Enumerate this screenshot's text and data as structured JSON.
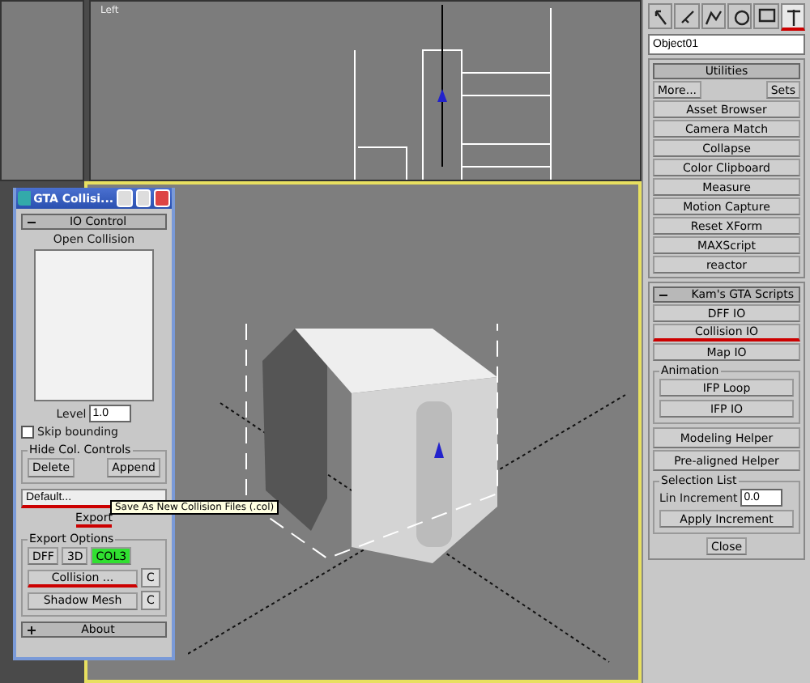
{
  "top_viewport": {
    "label": "Left"
  },
  "float_window": {
    "title": "GTA Collisi...",
    "io_rollout": {
      "title": "IO Control",
      "expanded": true,
      "open_label": "Open Collision",
      "level_label": "Level",
      "level_value": "1.0",
      "skip": {
        "label": "Skip bounding",
        "checked": false
      }
    },
    "hide_group": {
      "title": "Hide Col. Controls",
      "buttons": [
        "Delete",
        "Append"
      ]
    },
    "name_value": "Default...",
    "export_label": "Export",
    "export_group": {
      "title": "Export Options",
      "formats": [
        {
          "label": "DFF",
          "selected": false
        },
        {
          "label": "3D",
          "selected": false
        },
        {
          "label": "COL3",
          "selected": true
        }
      ]
    },
    "tooltip": "Save As New Collision Files (.col)",
    "rows": [
      {
        "label": "Collision ...",
        "value": "C",
        "underlined": true
      },
      {
        "label": "Shadow Mesh",
        "value": "C",
        "underlined": false
      }
    ],
    "about_rollout": {
      "title": "About",
      "expanded": false
    }
  },
  "command_panel": {
    "tabs": [
      {
        "selected": false
      },
      {
        "selected": false
      },
      {
        "selected": false
      },
      {
        "selected": false
      },
      {
        "selected": false
      },
      {
        "selected": true
      }
    ],
    "object_name": "Object01",
    "utilities": {
      "title": "Utilities",
      "more": "More...",
      "sets": "Sets",
      "items": [
        "Asset Browser",
        "Camera Match",
        "Collapse",
        "Color Clipboard",
        "Measure",
        "Motion Capture",
        "Reset XForm",
        "MAXScript",
        "reactor"
      ]
    },
    "scripts": {
      "title": "Kam's GTA Scripts",
      "expanded": true,
      "buttons": [
        {
          "label": "DFF IO",
          "underlined": false
        },
        {
          "label": "Collision IO",
          "underlined": true
        },
        {
          "label": "Map IO",
          "underlined": false
        }
      ],
      "animation_title": "Animation",
      "animation_buttons": [
        "IFP Loop",
        "IFP IO"
      ],
      "helpers": [
        "Modeling Helper",
        "Pre-aligned Helper"
      ],
      "selection_title": "Selection List",
      "increment_label": "Lin Increment",
      "increment_value": "0.0",
      "apply": "Apply Increment",
      "close": "Close"
    }
  }
}
